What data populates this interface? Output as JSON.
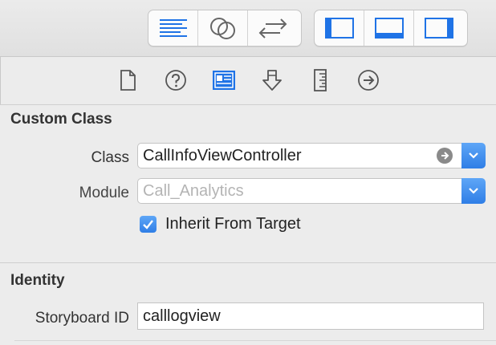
{
  "toolbar": {
    "left_group": [
      {
        "icon": "align-lines-icon"
      },
      {
        "icon": "overlapping-circles-icon"
      },
      {
        "icon": "swap-arrows-icon"
      }
    ],
    "right_group": [
      {
        "icon": "left-panel-icon"
      },
      {
        "icon": "bottom-panel-icon"
      },
      {
        "icon": "right-panel-icon"
      }
    ],
    "accent": "#1f73e6"
  },
  "inspector_tabs": [
    {
      "icon": "file-icon",
      "selected": false
    },
    {
      "icon": "help-icon",
      "selected": false
    },
    {
      "icon": "identity-card-icon",
      "selected": true
    },
    {
      "icon": "attributes-arrow-icon",
      "selected": false
    },
    {
      "icon": "ruler-icon",
      "selected": false
    },
    {
      "icon": "connections-arrow-icon",
      "selected": false
    }
  ],
  "custom_class": {
    "title": "Custom Class",
    "class_label": "Class",
    "class_value": "CallInfoViewController",
    "module_label": "Module",
    "module_placeholder": "Call_Analytics",
    "inherit_label": "Inherit From Target",
    "inherit_checked": true
  },
  "identity": {
    "title": "Identity",
    "storyboard_id_label": "Storyboard ID",
    "storyboard_id_value": "calllogview"
  }
}
